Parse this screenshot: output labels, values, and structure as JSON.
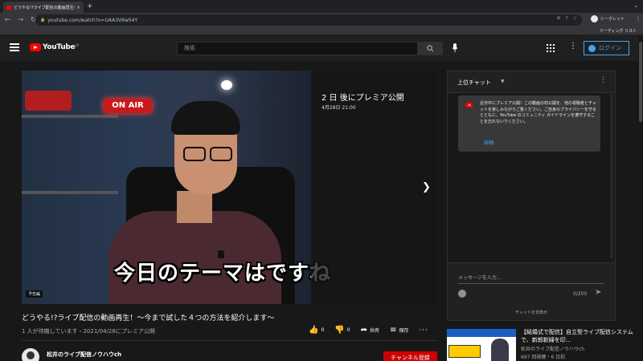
{
  "browser": {
    "tab_title": "どうやる!?ライブ配信の動画再生！...",
    "tab_close": "×",
    "new_tab": "+",
    "tabstrip_caret": "⌄",
    "url": "youtube.com/watch?v=UAA3V6wS4Y",
    "incognito_label": "シークレット",
    "reading_list": "リーディング リスト"
  },
  "header": {
    "logo_text": "YouTube",
    "logo_region": "JP",
    "search_placeholder": "検索",
    "login_label": "ログイン"
  },
  "player": {
    "premiere_title": "2 日 後にプレミア公開",
    "premiere_date": "4月28日 21:00",
    "caption": "今日のテーマはですね",
    "sign_text": "ON AIR",
    "trailer_badge": "予告編"
  },
  "video": {
    "title": "どうやる!?ライブ配信の動画再生！〜今まで試した４つの方法を紹介します〜",
    "meta": "1 人が待機しています・2021/04/28にプレミア公開",
    "like_count": "0",
    "dislike_count": "0",
    "share_label": "共有",
    "save_label": "保存",
    "channel_name": "松井のライブ配信ノウハウch",
    "subscribe_label": "チャンネル登録"
  },
  "chat": {
    "title": "上位チャット",
    "notice": "近日中にプレミア公開！この動画の初公開を、他の視聴者とチャットを楽しみながらご覧ください。ご自身のプライバシーを守るとともに、YouTube のコミュニティ ガイドラインを遵守することを忘れないでください。",
    "notice_link": "詳細",
    "input_placeholder": "メッセージを入力...",
    "char_count": "0/200",
    "hide_label": "チャットを非表示"
  },
  "recommendation": {
    "title": "【結婚式で配信】自立型ライブ配信システムで、新郎新婦を印...",
    "channel": "松井のライブ配信ノウハウch",
    "meta": "697 回視聴・6 日前"
  },
  "colors": {
    "accent": "#3ea6ff",
    "brand": "#ff0000",
    "subscribe": "#cc0000"
  }
}
